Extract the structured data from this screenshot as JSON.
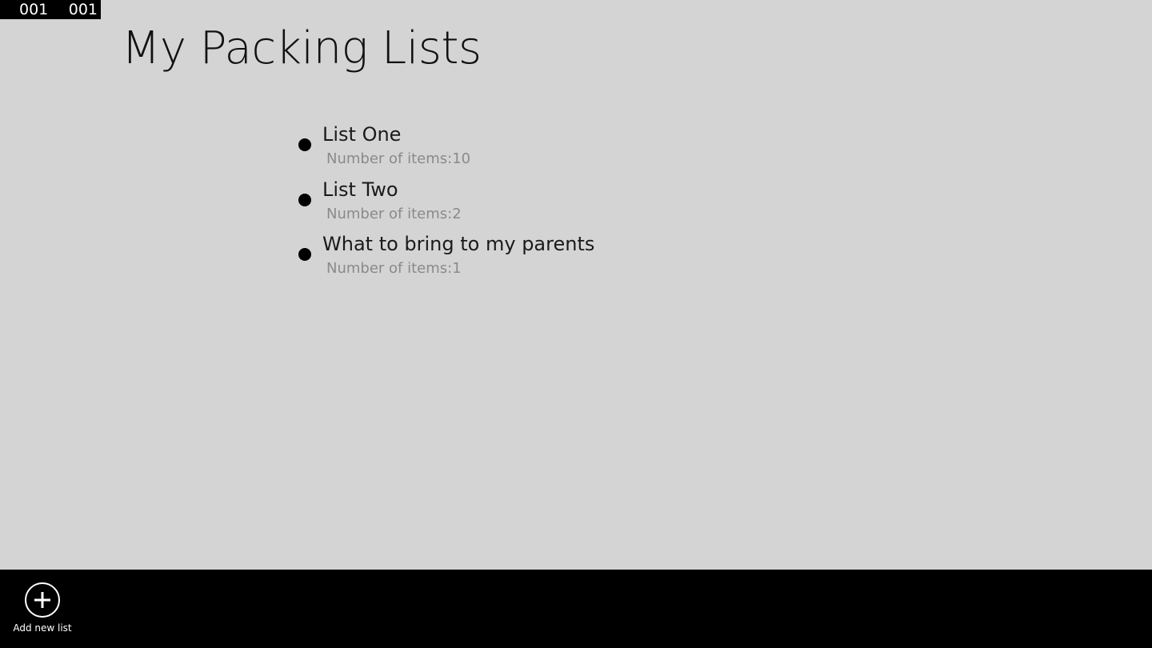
{
  "frame_counter": {
    "left": "001",
    "right": "001"
  },
  "page": {
    "title": "My Packing Lists"
  },
  "lists": [
    {
      "name": "List One",
      "count_text": "Number of items:10"
    },
    {
      "name": "List Two",
      "count_text": "Number of items:2"
    },
    {
      "name": "What to bring to my parents",
      "count_text": "Number of items:1"
    }
  ],
  "app_bar": {
    "add_button": {
      "label": "Add new list",
      "icon": "plus-circle-icon"
    }
  },
  "colors": {
    "background": "#d4d4d4",
    "app_bar": "#000000",
    "secondary_text": "#8a8a8a"
  }
}
